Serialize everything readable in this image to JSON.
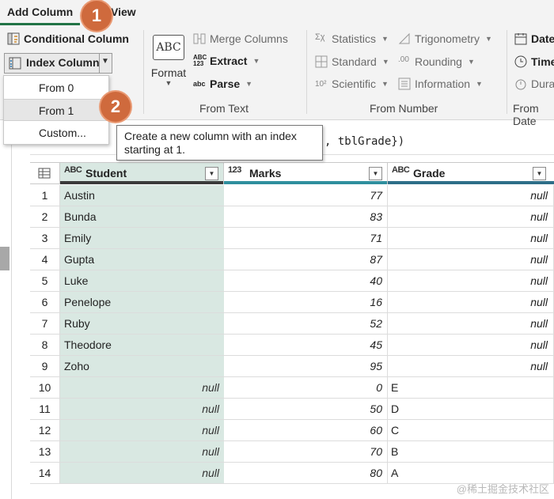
{
  "tabs": {
    "active": "Add Column",
    "next": "View"
  },
  "ribbon": {
    "general": {
      "conditional": "Conditional Column",
      "index": "Index Column"
    },
    "from_text": {
      "format": "Format",
      "merge": "Merge Columns",
      "extract": "Extract",
      "parse": "Parse",
      "group": "From Text"
    },
    "from_number": {
      "statistics": "Statistics",
      "standard": "Standard",
      "scientific": "Scientific",
      "trigonometry": "Trigonometry",
      "rounding": "Rounding",
      "information": "Information",
      "group": "From Number"
    },
    "from_date": {
      "date": "Date",
      "time": "Time",
      "duration": "Duration",
      "group": "From Date"
    }
  },
  "menu": {
    "items": [
      "From 0",
      "From 1",
      "Custom..."
    ],
    "highlighted": 1
  },
  "tooltip": {
    "line1": "Create a new column with an index",
    "line2": "starting at 1."
  },
  "badges": [
    "1",
    "2"
  ],
  "formula": {
    "text": ", tblGrade})"
  },
  "table": {
    "columns": [
      {
        "type": "ABC",
        "name": "Student",
        "bar_color": "#3a3a3a"
      },
      {
        "type": "123",
        "name": "Marks",
        "bar_color": "#2f8f9e"
      },
      {
        "type": "ABC",
        "name": "Grade",
        "bar_color": "#2e6e88"
      }
    ],
    "rows": [
      {
        "index": "1",
        "student": "Austin",
        "marks": "77",
        "grade": "null"
      },
      {
        "index": "2",
        "student": "Bunda",
        "marks": "83",
        "grade": "null"
      },
      {
        "index": "3",
        "student": "Emily",
        "marks": "71",
        "grade": "null"
      },
      {
        "index": "4",
        "student": "Gupta",
        "marks": "87",
        "grade": "null"
      },
      {
        "index": "5",
        "student": "Luke",
        "marks": "40",
        "grade": "null"
      },
      {
        "index": "6",
        "student": "Penelope",
        "marks": "16",
        "grade": "null"
      },
      {
        "index": "7",
        "student": "Ruby",
        "marks": "52",
        "grade": "null"
      },
      {
        "index": "8",
        "student": "Theodore",
        "marks": "45",
        "grade": "null"
      },
      {
        "index": "9",
        "student": "Zoho",
        "marks": "95",
        "grade": "null"
      },
      {
        "index": "10",
        "student": "null",
        "marks": "0",
        "grade": "E"
      },
      {
        "index": "11",
        "student": "null",
        "marks": "50",
        "grade": "D"
      },
      {
        "index": "12",
        "student": "null",
        "marks": "60",
        "grade": "C"
      },
      {
        "index": "13",
        "student": "null",
        "marks": "70",
        "grade": "B"
      },
      {
        "index": "14",
        "student": "null",
        "marks": "80",
        "grade": "A"
      }
    ]
  },
  "watermark": "@稀土掘金技术社区",
  "colors": {
    "accent": "#217346",
    "badge": "#cf6a3d",
    "selected_column": "#d9e8e2"
  }
}
